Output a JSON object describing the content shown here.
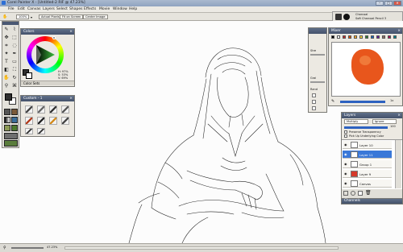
{
  "app": {
    "title": "Corel Painter X - [Untitled-2 RIF @ 47.23%]",
    "window_buttons": [
      "–",
      "□",
      "✕"
    ]
  },
  "menu": [
    "File",
    "Edit",
    "Canvas",
    "Layers",
    "Select",
    "Shapes",
    "Effects",
    "Movie",
    "Window",
    "Help"
  ],
  "property_bar": {
    "zoom_value": "100%",
    "actual_pixels": "Actual Pixels",
    "fit_on_screen": "Fit on Screen",
    "center_image": "Center Image"
  },
  "brush_selector": {
    "category": "Charcoal",
    "variant": "Soft Charcoal Pencil 3"
  },
  "colors_panel": {
    "title": "Colors",
    "readouts": [
      "H: 97%",
      "S: 53%",
      "V: 69%"
    ],
    "color_sets_label": "Color Sets"
  },
  "custom_panel": {
    "title": "Custom - 1"
  },
  "mixer_panel": {
    "title": "Mixer",
    "zoom_value": "1x",
    "swatches": [
      "#000000",
      "#ffffff",
      "#c62828",
      "#e65100",
      "#f9a825",
      "#fdd835",
      "#2e7d32",
      "#1565c0",
      "#6a1b9a",
      "#8d6e63",
      "#ad1457",
      "#00838f"
    ],
    "paint_color": "#e8561c"
  },
  "side_labels": {
    "strength": "Stre",
    "grain": "Grai",
    "randomness": "Rand"
  },
  "layers_panel": {
    "title": "Layers",
    "composite_method": "Multiply",
    "composite_depth": "Ignore",
    "opacity": "100",
    "preserve_transparency": "Preserve Transparency",
    "pick_up_underlying": "Pick Up Underlying Color",
    "layers": [
      {
        "name": "Layer 10",
        "selected": false,
        "thumb": "#ffffff"
      },
      {
        "name": "Layer 11",
        "selected": true,
        "thumb": "#ffffff"
      },
      {
        "name": "Group 1",
        "selected": false,
        "thumb": "#ffffff"
      },
      {
        "name": "Layer 9",
        "selected": false,
        "thumb": "#d6392a"
      },
      {
        "name": "Canvas",
        "selected": false,
        "thumb": "#ffffff"
      }
    ]
  },
  "channels_panel": {
    "title": "Channels"
  },
  "status_bar": {
    "zoom": "47.23%"
  },
  "colors": {
    "panel_header": "#4a5873",
    "selection": "#3a78d8",
    "main_color": "#2f2f2f"
  }
}
